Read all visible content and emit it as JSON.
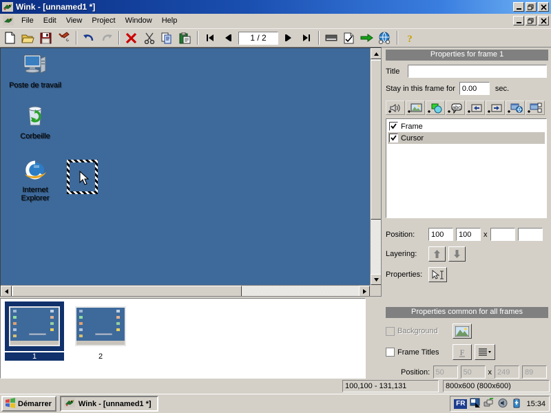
{
  "window": {
    "title": "Wink - [unnamed1 *]",
    "app_icon": "wink-parrot-icon",
    "minimize_label": "",
    "maximize_label": "",
    "close_label": ""
  },
  "menubar": {
    "items": [
      {
        "label": "File",
        "name": "menu-file"
      },
      {
        "label": "Edit",
        "name": "menu-edit"
      },
      {
        "label": "View",
        "name": "menu-view"
      },
      {
        "label": "Project",
        "name": "menu-project"
      },
      {
        "label": "Window",
        "name": "menu-window"
      },
      {
        "label": "Help",
        "name": "menu-help"
      }
    ]
  },
  "toolbar": {
    "buttons": [
      {
        "name": "new-file-button",
        "icon": "new-document-icon",
        "tooltip": "New"
      },
      {
        "name": "open-file-button",
        "icon": "open-folder-icon",
        "tooltip": "Open"
      },
      {
        "name": "save-file-button",
        "icon": "floppy-save-icon",
        "tooltip": "Save"
      },
      {
        "name": "build-button",
        "icon": "hammer-icon",
        "tooltip": "Render"
      },
      {
        "name": "undo-button",
        "icon": "undo-arrow-icon",
        "tooltip": "Undo"
      },
      {
        "name": "redo-button",
        "icon": "redo-arrow-icon",
        "tooltip": "Redo"
      },
      {
        "name": "delete-button",
        "icon": "red-x-icon",
        "tooltip": "Delete"
      },
      {
        "name": "cut-button",
        "icon": "scissors-icon",
        "tooltip": "Cut"
      },
      {
        "name": "copy-button",
        "icon": "copy-pages-icon",
        "tooltip": "Copy"
      },
      {
        "name": "paste-button",
        "icon": "clipboard-paste-icon",
        "tooltip": "Paste"
      },
      {
        "name": "first-frame-button",
        "icon": "skip-back-icon",
        "tooltip": "First frame"
      },
      {
        "name": "prev-frame-button",
        "icon": "step-back-icon",
        "tooltip": "Previous frame"
      },
      {
        "name": "next-frame-button",
        "icon": "step-forward-icon",
        "tooltip": "Next frame"
      },
      {
        "name": "last-frame-button",
        "icon": "skip-forward-icon",
        "tooltip": "Last frame"
      },
      {
        "name": "minimize-capture-button",
        "icon": "minimize-window-icon",
        "tooltip": "Minimize"
      },
      {
        "name": "select-frames-button",
        "icon": "checked-page-icon",
        "tooltip": "Select"
      },
      {
        "name": "export-button",
        "icon": "green-right-arrow-icon",
        "tooltip": "Export"
      },
      {
        "name": "preview-browser-button",
        "icon": "globe-icon",
        "tooltip": "Preview in browser"
      },
      {
        "name": "help-button",
        "icon": "question-mark-icon",
        "tooltip": "Help"
      }
    ],
    "page_indicator": "1 / 2"
  },
  "canvas": {
    "desktop_icons": [
      {
        "label": "Poste de travail",
        "icon": "my-computer-icon"
      },
      {
        "label": "Corbeille",
        "icon": "recycle-bin-icon"
      },
      {
        "label": "Internet\nExplorer",
        "icon": "internet-explorer-icon",
        "line1": "Internet",
        "line2": "Explorer"
      }
    ],
    "selected_object": {
      "name": "cursor-object",
      "icon": "mouse-pointer-icon"
    },
    "free_cursor": {
      "icon": "mouse-pointer-icon"
    }
  },
  "thumbnails": {
    "frames": [
      {
        "number": "1",
        "selected": true
      },
      {
        "number": "2",
        "selected": false
      }
    ]
  },
  "frame_properties": {
    "header": "Properties for frame 1",
    "title_label": "Title",
    "title_value": "",
    "stay_label": "Stay in this frame for",
    "stay_value": "0.00",
    "stay_unit": "sec.",
    "add_buttons": [
      {
        "name": "add-sound-button",
        "icon": "add-speaker-icon"
      },
      {
        "name": "add-image-button",
        "icon": "add-picture-icon"
      },
      {
        "name": "add-shape-button",
        "icon": "add-shape-icon"
      },
      {
        "name": "add-text-button",
        "icon": "add-textbox-icon"
      },
      {
        "name": "add-back-button",
        "icon": "add-left-arrow-button-icon"
      },
      {
        "name": "add-next-button",
        "icon": "add-right-arrow-button-icon"
      },
      {
        "name": "add-link-button",
        "icon": "add-browser-link-icon"
      },
      {
        "name": "add-subwindow-button",
        "icon": "add-subwindow-icon"
      }
    ],
    "objects": [
      {
        "label": "Frame",
        "checked": true,
        "selected": false
      },
      {
        "label": "Cursor",
        "checked": true,
        "selected": true
      }
    ],
    "position_label": "Position:",
    "position_x": "100",
    "position_y": "100",
    "position_sep": "x",
    "position_w": "",
    "position_h": "",
    "layering_label": "Layering:",
    "layer_up_icon": "arrow-up-icon",
    "layer_down_icon": "arrow-down-icon",
    "properties_label": "Properties:",
    "properties_icon": "cursor-text-properties-icon"
  },
  "common_properties": {
    "header": "Properties common for all frames",
    "background_label": "Background",
    "background_checked": false,
    "background_icon": "landscape-picture-icon",
    "frame_titles_label": "Frame Titles",
    "frame_titles_checked": false,
    "font_icon": "font-F-icon",
    "align_icon": "align-lines-icon",
    "position_label": "Position:",
    "position_x": "50",
    "position_y": "50",
    "position_sep": "x",
    "position_w": "249",
    "position_h": "89"
  },
  "statusbar": {
    "coords": "100,100 - 131,131",
    "size": "800x600 (800x600)"
  },
  "taskbar": {
    "start_label": "Démarrer",
    "start_icon": "windows-flag-icon",
    "task_label": "Wink - [unnamed1 *]",
    "task_icon": "wink-parrot-icon",
    "tray_lang": "FR",
    "tray_icons": [
      {
        "name": "display-settings-tray-icon"
      },
      {
        "name": "network-tray-icon"
      },
      {
        "name": "volume-tray-icon"
      },
      {
        "name": "battery-tray-icon"
      }
    ],
    "clock": "15:34"
  },
  "colors": {
    "titlebar_start": "#0b2e82",
    "titlebar_end": "#72b5f5",
    "face": "#d4d0c8",
    "desktop": "#3e6a9b",
    "panel_header": "#808080",
    "selection": "#10316b"
  }
}
